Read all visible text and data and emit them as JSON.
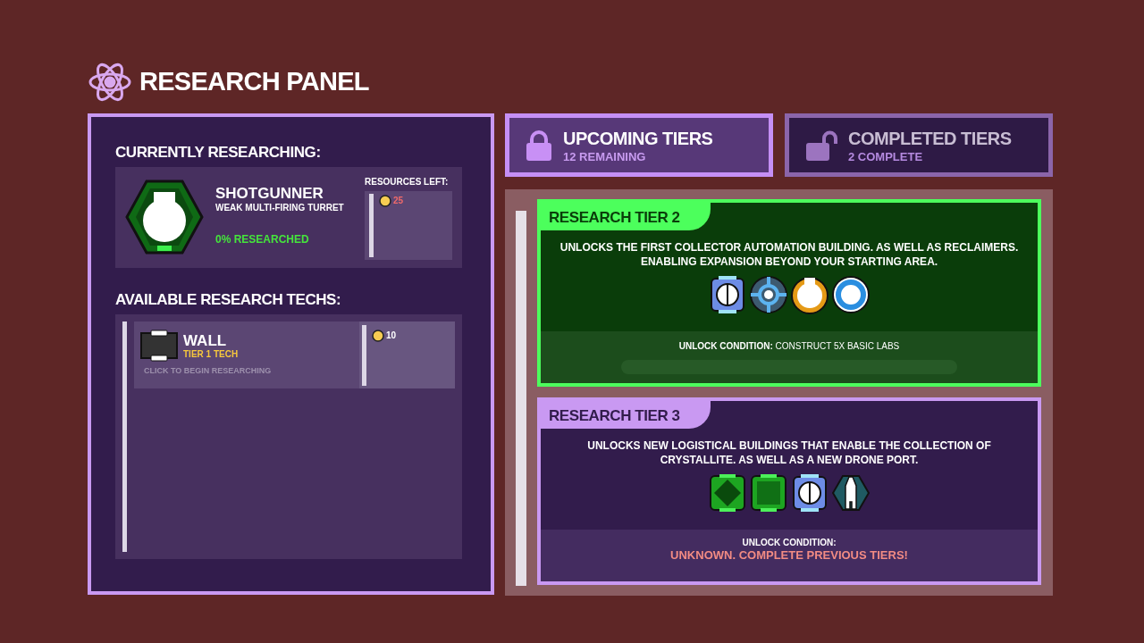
{
  "title": "RESEARCH PANEL",
  "current": {
    "heading": "CURRENTLY RESEARCHING:",
    "name": "SHOTGUNNER",
    "description": "WEAK MULTI-FIRING TURRET",
    "progress": "0% RESEARCHED",
    "resources_label": "RESOURCES LEFT:",
    "resources": [
      {
        "amount": "25"
      }
    ]
  },
  "available": {
    "heading": "AVAILABLE RESEARCH TECHS:",
    "techs": [
      {
        "name": "WALL",
        "tier": "TIER 1 TECH",
        "hint": "CLICK TO BEGIN RESEARCHING",
        "cost": "10"
      }
    ]
  },
  "tabs": [
    {
      "label": "UPCOMING TIERS",
      "count": "12 REMAINING",
      "selected": true
    },
    {
      "label": "COMPLETED TIERS",
      "count": "2 COMPLETE",
      "selected": false
    }
  ],
  "tiers": [
    {
      "title": "RESEARCH TIER 2",
      "kind": "active",
      "description": "UNLOCKS THE FIRST COLLECTOR AUTOMATION BUILDING. AS WELL AS RECLAIMERS. ENABLING EXPANSION BEYOND YOUR STARTING AREA.",
      "unlock_label": "UNLOCK CONDITION:",
      "unlock_value": "CONSTRUCT 5X BASIC LABS",
      "level": 0
    },
    {
      "title": "RESEARCH TIER 3",
      "kind": "locked",
      "description": "UNLOCKS NEW LOGISTICAL BUILDINGS THAT ENABLE THE COLLECTION OF CRYSTALLITE. AS WELL AS A NEW DRONE PORT.",
      "unlock_label": "UNLOCK CONDITION:",
      "unlock_value": "UNKNOWN. COMPLETE PREVIOUS TIERS!"
    }
  ]
}
